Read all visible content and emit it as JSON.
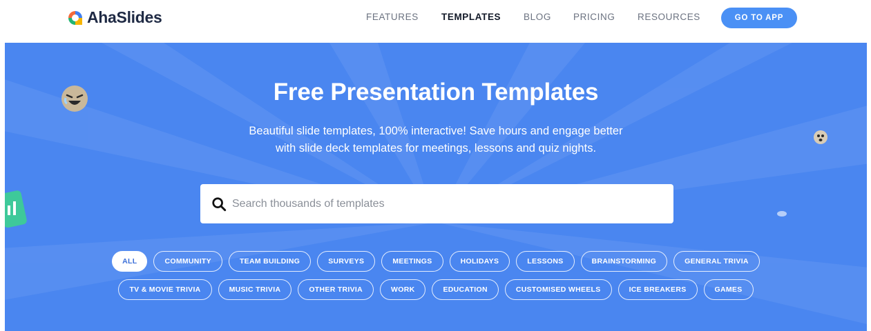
{
  "header": {
    "logo_text": "AhaSlides",
    "nav": [
      {
        "label": "FEATURES",
        "active": false
      },
      {
        "label": "TEMPLATES",
        "active": true
      },
      {
        "label": "BLOG",
        "active": false
      },
      {
        "label": "PRICING",
        "active": false
      },
      {
        "label": "RESOURCES",
        "active": false
      }
    ],
    "cta_label": "GO TO APP"
  },
  "hero": {
    "title": "Free Presentation Templates",
    "subtitle_line1": "Beautiful slide templates, 100% interactive! Save hours and engage better",
    "subtitle_line2": "with slide deck templates for meetings, lessons and quiz nights.",
    "search": {
      "placeholder": "Search thousands of templates",
      "icon": "search-icon"
    },
    "categories_row1": [
      "ALL",
      "COMMUNITY",
      "TEAM BUILDING",
      "SURVEYS",
      "MEETINGS",
      "HOLIDAYS",
      "LESSONS",
      "BRAINSTORMING",
      "GENERAL TRIVIA"
    ],
    "categories_row2": [
      "TV & MOVIE TRIVIA",
      "MUSIC TRIVIA",
      "OTHER TRIVIA",
      "WORK",
      "EDUCATION",
      "CUSTOMISED WHEELS",
      "ICE BREAKERS",
      "GAMES"
    ],
    "active_category": "ALL"
  },
  "colors": {
    "hero_bg": "#4a86f0",
    "cta_bg": "#4a90f5",
    "logo_orange": "#f26b3a",
    "logo_blue": "#3f7ff0",
    "logo_yellow": "#f7b500",
    "logo_green": "#22b573"
  }
}
